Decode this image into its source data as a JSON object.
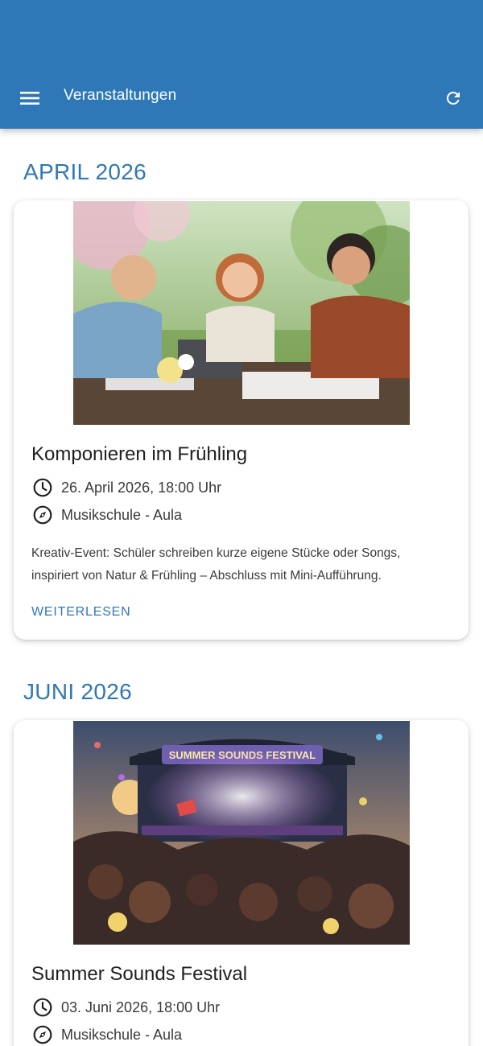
{
  "theme": {
    "primary": "#2f78b7",
    "text_dark": "#1f1f1f",
    "text_body": "#3a3a3a"
  },
  "appbar": {
    "menu_icon": "hamburger-menu-icon",
    "title": "Veranstaltungen",
    "refresh_icon": "refresh-icon"
  },
  "sections": [
    {
      "month": "APRIL 2026",
      "events": [
        {
          "image_icon": "photo-students-composing-outdoors",
          "title": "Komponieren im Frühling",
          "datetime": "26. April 2026, 18:00 Uhr",
          "location": "Musikschule - Aula",
          "description_line1": "Kreativ-Event: Schüler schreiben kurze eigene Stücke oder Songs,",
          "description_line2": "inspiriert von Natur & Frühling – Abschluss mit Mini-Aufführung.",
          "read_more": "WEITERLESEN"
        }
      ]
    },
    {
      "month": "JUNI 2026",
      "events": [
        {
          "image_icon": "photo-festival-stage-crowd",
          "image_banner": "SUMMER SOUNDS FESTIVAL",
          "title": "Summer Sounds Festival",
          "datetime": "03. Juni 2026, 18:00 Uhr",
          "location": "Musikschule - Aula"
        }
      ]
    }
  ],
  "icons": {
    "time": "clock-icon",
    "location": "compass-icon"
  }
}
